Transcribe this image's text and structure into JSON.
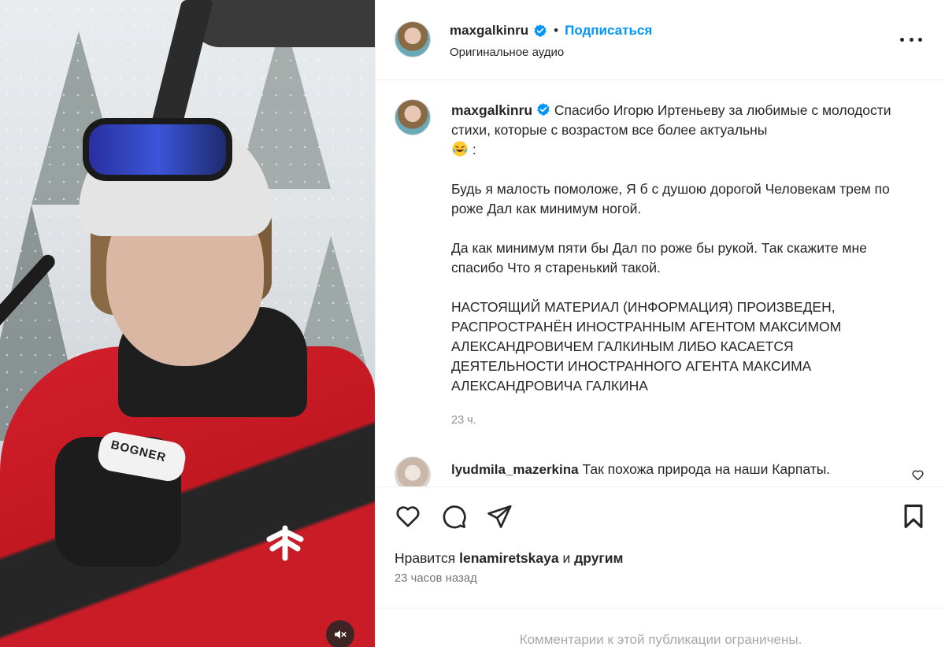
{
  "post": {
    "author": {
      "username": "maxgalkinru",
      "verified": true,
      "verified_icon": "verified-badge-icon",
      "verified_color": "#0095f6"
    },
    "follow_label": "Подписаться",
    "separator": "•",
    "audio_label": "Оригинальное аудио",
    "more_icon": "more-horizontal-icon",
    "media": {
      "glove_brand": "BOGNER",
      "mute_icon": "speaker-muted-icon"
    }
  },
  "caption": {
    "username": "maxgalkinru",
    "intro": "Спасибо Игорю Иртеньеву за любимые с молодости стихи, которые с возрастом все более актуальны",
    "emoji_icon": "rolling-on-floor-laughing-emoji",
    "intro_tail": ":",
    "stanza1": "Будь я малость помоложе, Я б с душою дорогой Человекам трем по роже Дал как минимум ногой.",
    "stanza2": "Да как минимум пяти бы Дал по роже бы рукой. Так скажите мне спасибо Что я старенький такой.",
    "disclaimer": "НАСТОЯЩИЙ МАТЕРИАЛ (ИНФОРМАЦИЯ) ПРОИЗВЕДЕН, РАСПРОСТРАНЁН ИНОСТРАННЫМ АГЕНТОМ МАКСИМОМ АЛЕКСАНДРОВИЧЕМ ГАЛКИНЫМ ЛИБО КАСАЕТСЯ ДЕЯТЕЛЬНОСТИ ИНОСТРАННОГО АГЕНТА МАКСИМА АЛЕКСАНДРОВИЧА ГАЛКИНА",
    "time": "23 ч."
  },
  "comments": [
    {
      "username": "lyudmila_mazerkina",
      "text": "Так похожа природа на наши Карпаты.",
      "like_icon": "heart-outline-icon"
    }
  ],
  "actions": {
    "like_icon": "heart-outline-icon",
    "comment_icon": "comment-bubble-icon",
    "share_icon": "paper-plane-icon",
    "save_icon": "bookmark-icon"
  },
  "likes": {
    "prefix": "Нравится",
    "user": "lenamiretskaya",
    "conj": "и",
    "others": "другим"
  },
  "timestamp": "23 часов назад",
  "comments_restricted": "Комментарии к этой публикации ограничены."
}
